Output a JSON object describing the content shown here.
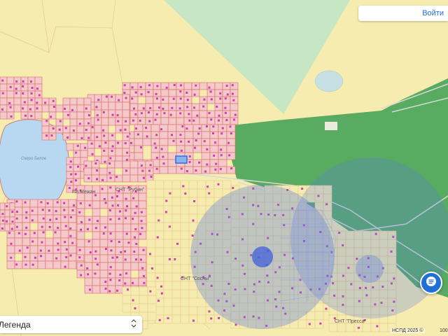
{
  "header": {
    "login_label": "Войти"
  },
  "legend": {
    "label": "Легенда",
    "expand_icon": "chevron-updown-icon"
  },
  "map": {
    "lake_label": "Озеро Белое",
    "snt_labels": [
      "СНТ \"Рубин\"",
      "СНТ \"Сосны\"",
      "СНТ \"Пресса\""
    ],
    "small_labels": [
      "Пл.Межан"
    ],
    "colors": {
      "background": "#f7ecb0",
      "forest": "#4fa85c",
      "light_green": "#c7e6c4",
      "water": "#b8d8f2",
      "parcel_pink": "#f3c9c9",
      "parcel_outline": "#e06a6a",
      "building": "#d23fb0",
      "circle_blue": "#5b7de0",
      "selected_parcel": "#2f6fd6"
    }
  },
  "chat_button": {
    "icon": "chat-bubble-icon"
  },
  "footer": {
    "copyright": "НСПД 2025 ©",
    "scale": "100"
  }
}
